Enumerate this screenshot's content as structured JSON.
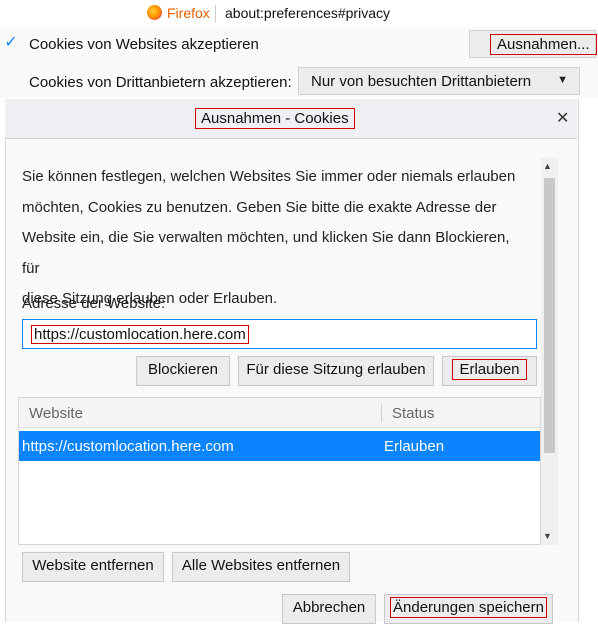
{
  "browser": {
    "name": "Firefox",
    "url": "about:preferences#privacy",
    "icon": "firefox-logo-icon"
  },
  "prefs": {
    "accept_cookies_label": "Cookies von Websites akzeptieren",
    "accept_cookies_checked": true,
    "exceptions_button": "Ausnahmen...",
    "third_party_label": "Cookies von Drittanbietern akzeptieren:",
    "third_party_value": "Nur von besuchten Drittanbietern"
  },
  "dialog": {
    "title": "Ausnahmen - Cookies",
    "close_icon": "close-icon",
    "description_lines": [
      "Sie können festlegen, welchen Websites Sie immer oder niemals erlauben",
      "möchten, Cookies zu benutzen. Geben Sie bitte die exakte Adresse der",
      "Website ein, die Sie verwalten möchten, und klicken Sie dann Blockieren, für",
      "diese Sitzung erlauben oder Erlauben."
    ],
    "address_label": "Adresse der Website:",
    "address_value": "https://customlocation.here.com",
    "buttons": {
      "block": "Blockieren",
      "allow_session": "Für diese Sitzung erlauben",
      "allow": "Erlauben",
      "remove": "Website entfernen",
      "remove_all": "Alle Websites entfernen",
      "cancel": "Abbrechen",
      "save": "Änderungen speichern"
    },
    "table": {
      "columns": [
        "Website",
        "Status"
      ],
      "rows": [
        {
          "website": "https://customlocation.here.com",
          "status": "Erlauben",
          "selected": true
        }
      ]
    }
  },
  "colors": {
    "accent": "#0a84ff",
    "highlight_box": "#d40000",
    "firefox_orange": "#e66000"
  }
}
